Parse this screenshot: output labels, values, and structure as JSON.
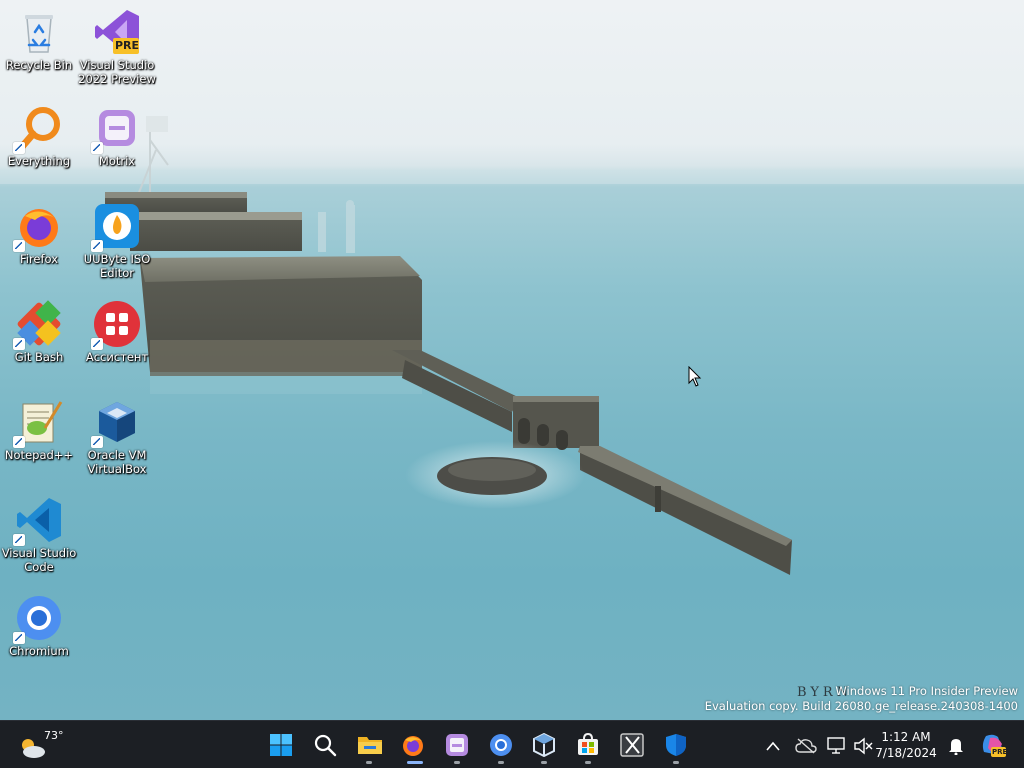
{
  "desktop": {
    "icons": [
      {
        "label": "Recycle Bin",
        "icon": "recycle-bin-icon",
        "shortcut": false
      },
      {
        "label": "Visual Studio 2022 Preview",
        "icon": "visual-studio-preview-icon",
        "badge": "PRE",
        "shortcut": false
      },
      {
        "label": "Everything",
        "icon": "everything-search-icon",
        "shortcut": true
      },
      {
        "label": "Motrix",
        "icon": "motrix-icon",
        "shortcut": true
      },
      {
        "label": "Firefox",
        "icon": "firefox-icon",
        "shortcut": true
      },
      {
        "label": "UUByte ISO Editor",
        "icon": "uubyte-iso-editor-icon",
        "shortcut": true
      },
      {
        "label": "Git Bash",
        "icon": "git-bash-icon",
        "shortcut": true
      },
      {
        "label": "Ассистент",
        "icon": "assistant-icon",
        "shortcut": true
      },
      {
        "label": "Notepad++",
        "icon": "notepad-plus-plus-icon",
        "shortcut": true
      },
      {
        "label": "Oracle VM VirtualBox",
        "icon": "virtualbox-icon",
        "shortcut": true
      },
      {
        "label": "Visual Studio Code",
        "icon": "vscode-icon",
        "shortcut": true
      },
      {
        "label": "Chromium",
        "icon": "chromium-icon",
        "shortcut": true
      }
    ]
  },
  "watermark": {
    "line1": "Windows 11 Pro Insider Preview",
    "line2": "Evaluation copy. Build 26080.ge_release.240308-1400",
    "photographer": "BYRN"
  },
  "taskbar": {
    "weather": {
      "temp": "73°",
      "icon": "weather-cloudy-icon"
    },
    "pinned": [
      {
        "name": "start-button",
        "icon": "windows-start-icon"
      },
      {
        "name": "search-button",
        "icon": "search-icon"
      },
      {
        "name": "file-explorer",
        "icon": "file-explorer-icon"
      },
      {
        "name": "firefox",
        "icon": "firefox-icon"
      },
      {
        "name": "motrix",
        "icon": "motrix-icon"
      },
      {
        "name": "chromium",
        "icon": "chromium-icon"
      },
      {
        "name": "virtualbox",
        "icon": "virtualbox-icon"
      },
      {
        "name": "microsoft-store",
        "icon": "store-icon"
      },
      {
        "name": "snipping-tool",
        "icon": "snipping-tool-icon"
      },
      {
        "name": "windows-security",
        "icon": "shield-icon"
      }
    ],
    "tray": {
      "time": "1:12 AM",
      "date": "7/18/2024",
      "icons": [
        "chevron-up-icon",
        "onedrive-off-icon",
        "network-icon",
        "volume-muted-icon",
        "notification-bell-icon",
        "copilot-icon"
      ],
      "copilot_badge": "PRE"
    }
  },
  "colors": {
    "taskbar_bg": "#1c1f24",
    "accent": "#0078d4",
    "sea": "#79b7c6"
  }
}
